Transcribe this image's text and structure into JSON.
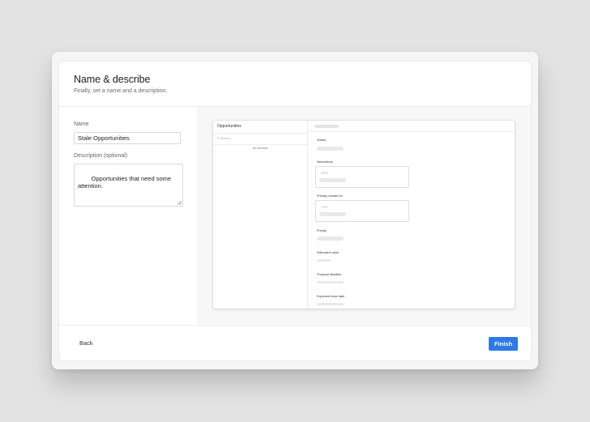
{
  "dialog": {
    "title": "Name & describe",
    "subtitle": "Finally, set a name and a description."
  },
  "form": {
    "name_label": "Name",
    "name_value": "Stale Opportunities",
    "description_label": "Description (optional)",
    "description_value": "Opportunities that need some\nattention."
  },
  "preview": {
    "list_title": "Opportunities",
    "search_placeholder": "Search...",
    "empty_text": "No records",
    "fields": [
      "Status",
      "Interactions",
      "Primary contact for",
      "Priority",
      "Estimated value",
      "Proposal deadline",
      "Expected close date"
    ]
  },
  "footer": {
    "back_label": "Back",
    "finish_label": "Finish"
  },
  "colors": {
    "accent": "#2c7be5",
    "background": "#e3e3e3"
  }
}
